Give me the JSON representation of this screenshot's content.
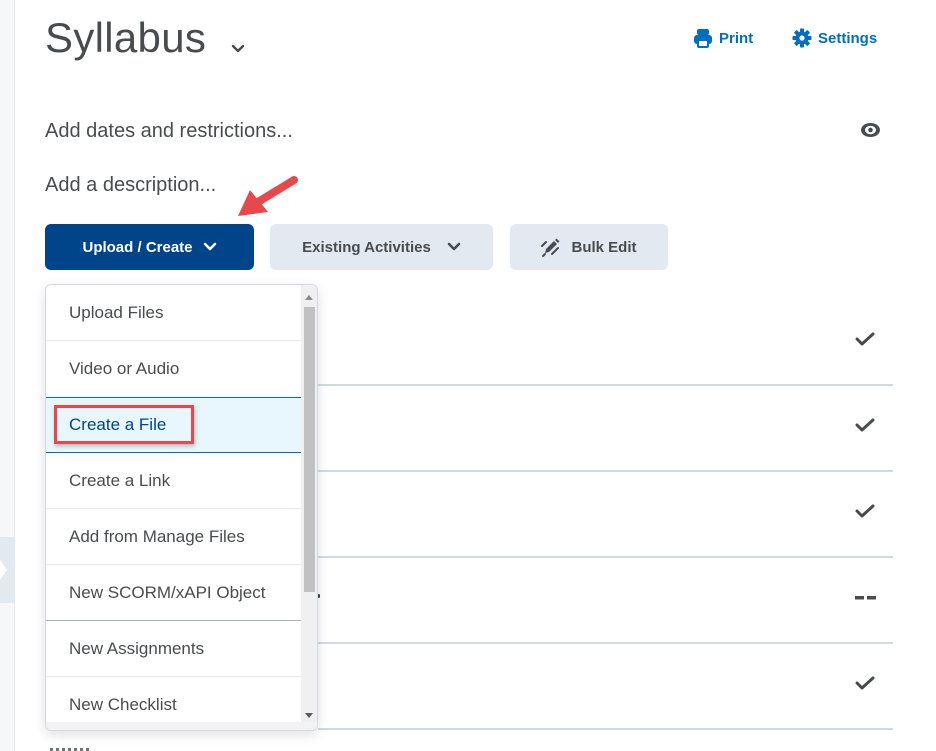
{
  "header": {
    "title": "Syllabus",
    "print_label": "Print",
    "settings_label": "Settings"
  },
  "meta": {
    "dates_label": "Add dates and restrictions...",
    "description_label": "Add a description..."
  },
  "toolbar": {
    "upload_create_label": "Upload / Create",
    "existing_activities_label": "Existing Activities",
    "bulk_edit_label": "Bulk Edit"
  },
  "menu": {
    "items": [
      {
        "label": "Upload Files"
      },
      {
        "label": "Video or Audio"
      },
      {
        "label": "Create a File",
        "highlighted": true
      },
      {
        "label": "Create a Link"
      },
      {
        "label": "Add from Manage Files"
      },
      {
        "label": "New SCORM/xAPI Object"
      },
      {
        "label": "New Assignments"
      },
      {
        "label": "New Checklist"
      }
    ]
  },
  "rows": [
    {
      "status": "check"
    },
    {
      "status": "check"
    },
    {
      "status": "check"
    },
    {
      "status": "dash",
      "status_text": "--"
    },
    {
      "status": "check"
    }
  ],
  "colors": {
    "primary": "#004489",
    "link": "#006fbf",
    "annotation": "#e8484c",
    "active_bg": "#e8f7fd"
  }
}
